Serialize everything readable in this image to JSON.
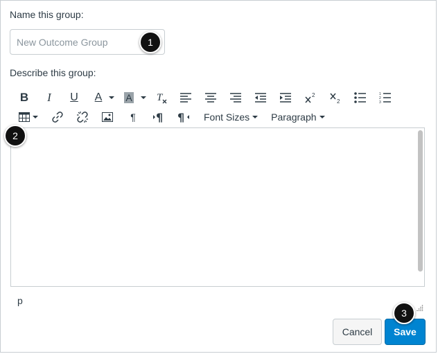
{
  "form": {
    "name_label": "Name this group:",
    "name_placeholder": "New Outcome Group",
    "name_value": "",
    "description_label": "Describe this group:"
  },
  "toolbar": {
    "row1": [
      {
        "icon": "bold-icon",
        "glyph": "B"
      },
      {
        "icon": "italic-icon",
        "glyph": "I"
      },
      {
        "icon": "underline-icon",
        "glyph": "U"
      },
      {
        "icon": "text-color-icon",
        "glyph": "A",
        "dropdown": true
      },
      {
        "icon": "background-color-icon",
        "glyph": "A",
        "dropdown": true
      },
      {
        "icon": "clear-formatting-icon",
        "glyph": "T"
      },
      {
        "icon": "align-left-icon"
      },
      {
        "icon": "align-center-icon"
      },
      {
        "icon": "align-right-icon"
      },
      {
        "icon": "outdent-icon"
      },
      {
        "icon": "indent-icon"
      },
      {
        "icon": "superscript-icon",
        "glyph": "x",
        "sup": "2"
      },
      {
        "icon": "subscript-icon",
        "glyph": "x",
        "sub": "2"
      },
      {
        "icon": "bullet-list-icon"
      },
      {
        "icon": "numbered-list-icon"
      }
    ],
    "row2": [
      {
        "icon": "table-icon",
        "dropdown": true
      },
      {
        "icon": "link-icon"
      },
      {
        "icon": "unlink-icon"
      },
      {
        "icon": "image-icon"
      },
      {
        "icon": "paragraph-mark-icon",
        "glyph": "¶"
      },
      {
        "icon": "ltr-direction-icon",
        "glyph": "¶"
      },
      {
        "icon": "rtl-direction-icon",
        "glyph": "¶"
      }
    ],
    "font_sizes_label": "Font Sizes",
    "paragraph_label": "Paragraph"
  },
  "editor": {
    "content": "",
    "status_path": "p"
  },
  "buttons": {
    "cancel": "Cancel",
    "save": "Save"
  },
  "callouts": {
    "one": "1",
    "two": "2",
    "three": "3"
  },
  "colors": {
    "save_button": "#0084d1",
    "callout_badge": "#111111",
    "border": "#c7cdd1"
  }
}
